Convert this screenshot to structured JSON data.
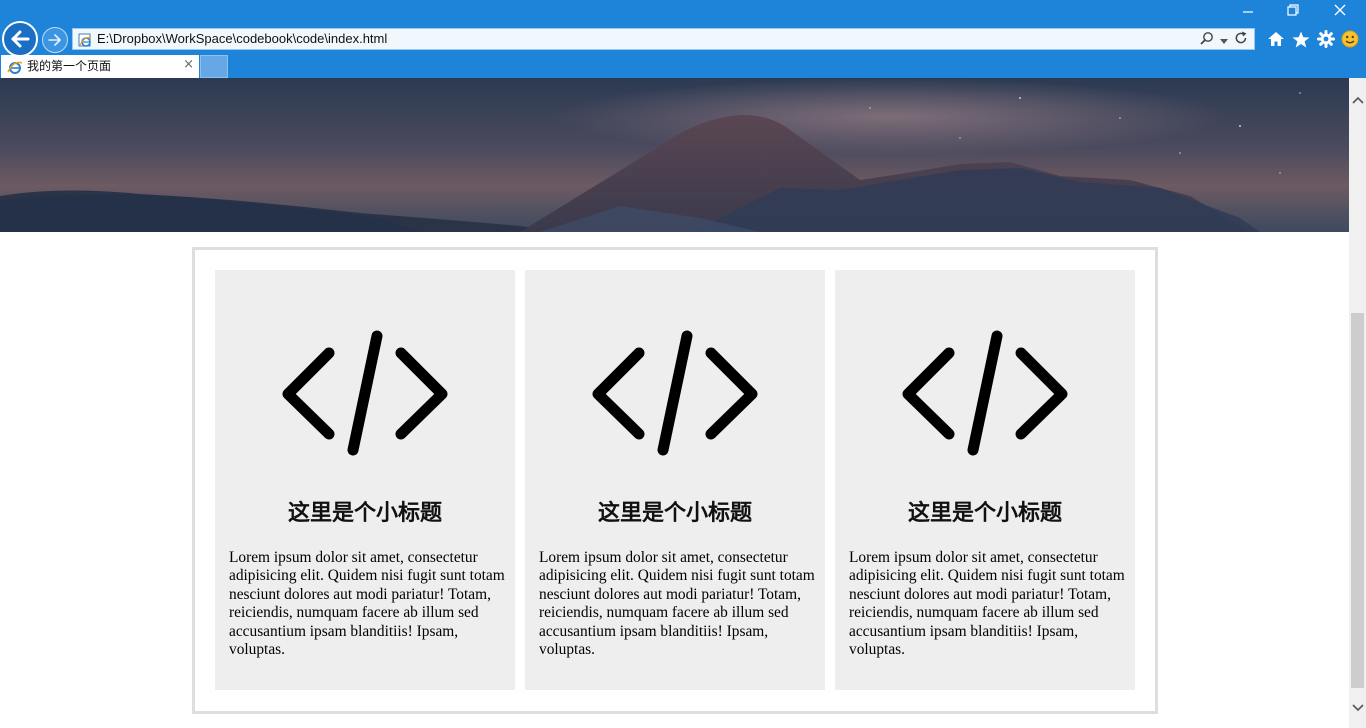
{
  "browser": {
    "address": "E:\\Dropbox\\WorkSpace\\codebook\\code\\index.html",
    "tab_title": "我的第一个页面",
    "tab_close": "×"
  },
  "cards": [
    {
      "title": "这里是个小标题",
      "text": "Lorem ipsum dolor sit amet, consectetur adipisicing elit. Quidem nisi fugit sunt totam nesciunt dolores aut modi pariatur! Totam, reiciendis, numquam facere ab illum sed accusantium ipsam blanditiis! Ipsam, voluptas.",
      "icon": "code-icon"
    },
    {
      "title": "这里是个小标题",
      "text": "Lorem ipsum dolor sit amet, consectetur adipisicing elit. Quidem nisi fugit sunt totam nesciunt dolores aut modi pariatur! Totam, reiciendis, numquam facere ab illum sed accusantium ipsam blanditiis! Ipsam, voluptas.",
      "icon": "code-icon"
    },
    {
      "title": "这里是个小标题",
      "text": "Lorem ipsum dolor sit amet, consectetur adipisicing elit. Quidem nisi fugit sunt totam nesciunt dolores aut modi pariatur! Totam, reiciendis, numquam facere ab illum sed accusantium ipsam blanditiis! Ipsam, voluptas.",
      "icon": "code-icon"
    }
  ],
  "colors": {
    "chrome_blue": "#1e84d9",
    "card_background": "#eeeeee",
    "container_border": "#dedede"
  }
}
